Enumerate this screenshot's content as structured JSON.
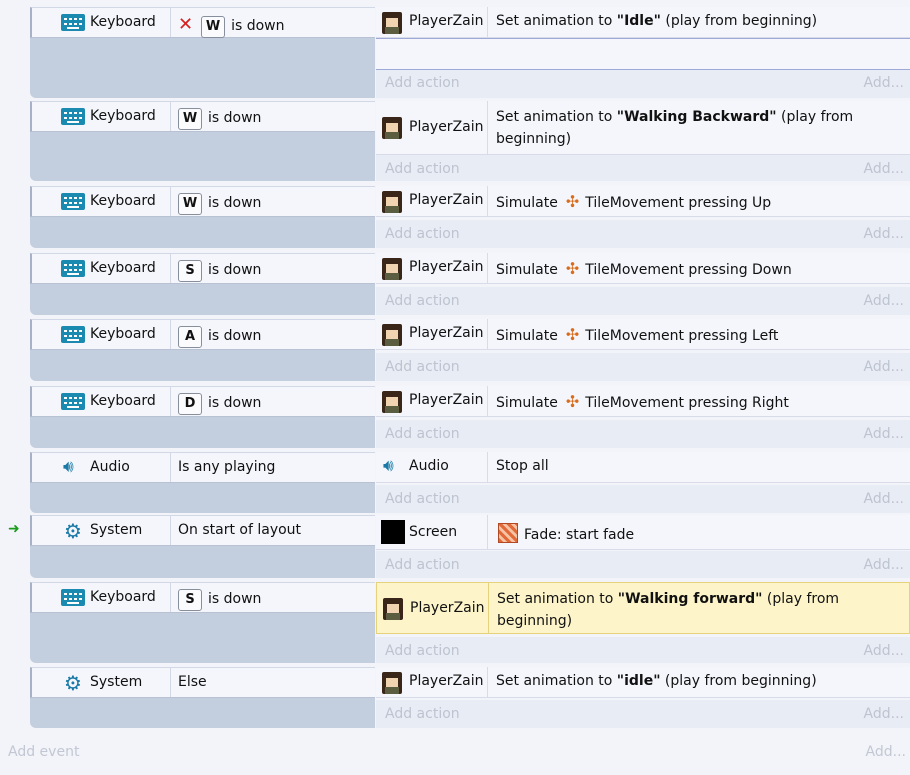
{
  "add_action_label": "Add action",
  "add_short_label": "Add...",
  "add_event_label": "Add event",
  "events": [
    {
      "condition": {
        "object": "Keyboard",
        "icon": "keyboard-icon",
        "key": "W",
        "text": "is down",
        "inverted": true
      },
      "actions": [
        {
          "object": "PlayerZain",
          "icon": "player-avatar-icon",
          "prefix": "Set animation to ",
          "bold": "\"Idle\"",
          "suffix": " (play from beginning)"
        }
      ]
    },
    {
      "condition": {
        "object": "Keyboard",
        "icon": "keyboard-icon",
        "key": "W",
        "text": "is down"
      },
      "actions": [
        {
          "object": "PlayerZain",
          "icon": "player-avatar-icon",
          "prefix": "Set animation to ",
          "bold": "\"Walking Backward\"",
          "suffix": " (play from beginning)"
        }
      ]
    },
    {
      "condition": {
        "object": "Keyboard",
        "icon": "keyboard-icon",
        "key": "W",
        "text": "is down"
      },
      "actions": [
        {
          "object": "PlayerZain",
          "icon": "player-avatar-icon",
          "prefix": "Simulate",
          "behavior": "TileMovement",
          "suffix": "pressing Up"
        }
      ]
    },
    {
      "condition": {
        "object": "Keyboard",
        "icon": "keyboard-icon",
        "key": "S",
        "text": "is down"
      },
      "actions": [
        {
          "object": "PlayerZain",
          "icon": "player-avatar-icon",
          "prefix": "Simulate",
          "behavior": "TileMovement",
          "suffix": "pressing Down"
        }
      ]
    },
    {
      "condition": {
        "object": "Keyboard",
        "icon": "keyboard-icon",
        "key": "A",
        "text": "is down"
      },
      "actions": [
        {
          "object": "PlayerZain",
          "icon": "player-avatar-icon",
          "prefix": "Simulate",
          "behavior": "TileMovement",
          "suffix": "pressing Left"
        }
      ]
    },
    {
      "condition": {
        "object": "Keyboard",
        "icon": "keyboard-icon",
        "key": "D",
        "text": "is down"
      },
      "actions": [
        {
          "object": "PlayerZain",
          "icon": "player-avatar-icon",
          "prefix": "Simulate",
          "behavior": "TileMovement",
          "suffix": "pressing Right"
        }
      ]
    },
    {
      "condition": {
        "object": "Audio",
        "icon": "speaker-icon",
        "text": "Is any playing"
      },
      "actions": [
        {
          "object": "Audio",
          "icon": "speaker-icon",
          "prefix": "Stop all"
        }
      ]
    },
    {
      "condition": {
        "object": "System",
        "icon": "gear-icon",
        "text": "On start of layout",
        "trigger": true
      },
      "actions": [
        {
          "object": "Screen",
          "icon": "screen-icon",
          "prefix": "Fade: start fade"
        }
      ]
    },
    {
      "condition": {
        "object": "Keyboard",
        "icon": "keyboard-icon",
        "key": "S",
        "text": "is down"
      },
      "actions": [
        {
          "object": "PlayerZain",
          "icon": "player-avatar-icon",
          "prefix": "Set animation to ",
          "bold": "\"Walking forward\"",
          "suffix": " (play from beginning)",
          "selected": true
        }
      ]
    },
    {
      "condition": {
        "object": "System",
        "icon": "gear-icon",
        "text": "Else"
      },
      "actions": [
        {
          "object": "PlayerZain",
          "icon": "player-avatar-icon",
          "prefix": "Set animation to ",
          "bold": "\"idle\"",
          "suffix": " (play from beginning)"
        }
      ]
    }
  ]
}
